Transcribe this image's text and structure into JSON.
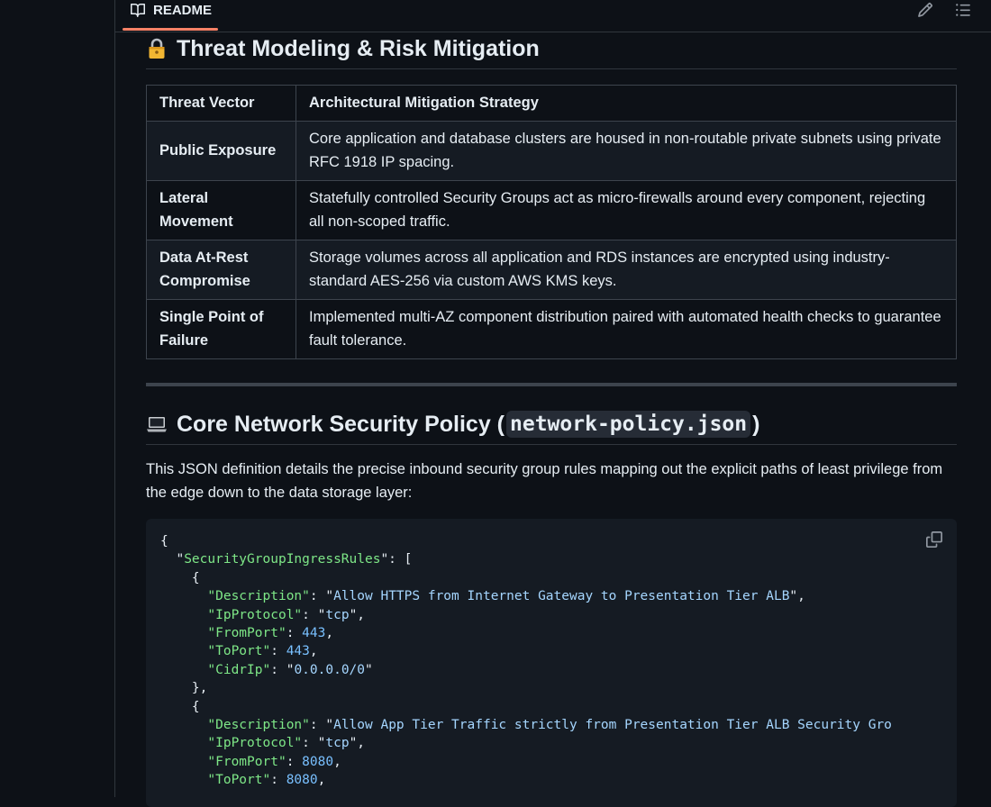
{
  "readme": {
    "tab_label": "README"
  },
  "section1": {
    "title": "Threat Modeling & Risk Mitigation",
    "icon": "lock-icon",
    "table": {
      "headers": [
        "Threat Vector",
        "Architectural Mitigation Strategy"
      ],
      "rows": [
        [
          "Public Exposure",
          "Core application and database clusters are housed in non-routable private subnets using private RFC 1918 IP spacing."
        ],
        [
          "Lateral Movement",
          "Statefully controlled Security Groups act as micro-firewalls around every component, rejecting all non-scoped traffic."
        ],
        [
          "Data At-Rest Compromise",
          "Storage volumes across all application and RDS instances are encrypted using industry-standard AES-256 via custom AWS KMS keys."
        ],
        [
          "Single Point of Failure",
          "Implemented multi-AZ component distribution paired with automated health checks to guarantee fault tolerance."
        ]
      ]
    }
  },
  "section2": {
    "title_prefix": "Core Network Security Policy (",
    "title_code": "network-policy.json",
    "title_suffix": ")",
    "icon": "laptop-icon",
    "intro": "This JSON definition details the precise inbound security group rules mapping out the explicit paths of least privilege from the edge down to the data storage layer:",
    "code": {
      "root_key": "SecurityGroupIngressRules",
      "rules": [
        {
          "Description": "Allow HTTPS from Internet Gateway to Presentation Tier ALB",
          "IpProtocol": "tcp",
          "FromPort": 443,
          "ToPort": 443,
          "CidrIp": "0.0.0.0/0"
        },
        {
          "Description": "Allow App Tier Traffic strictly from Presentation Tier ALB Security Gro",
          "IpProtocol": "tcp",
          "FromPort": 8080,
          "ToPort": 8080
        }
      ]
    }
  },
  "colors": {
    "tab_underline": "#f78166",
    "json_key": "#7ee787",
    "json_string": "#a5d6ff",
    "json_number": "#79c0ff"
  }
}
